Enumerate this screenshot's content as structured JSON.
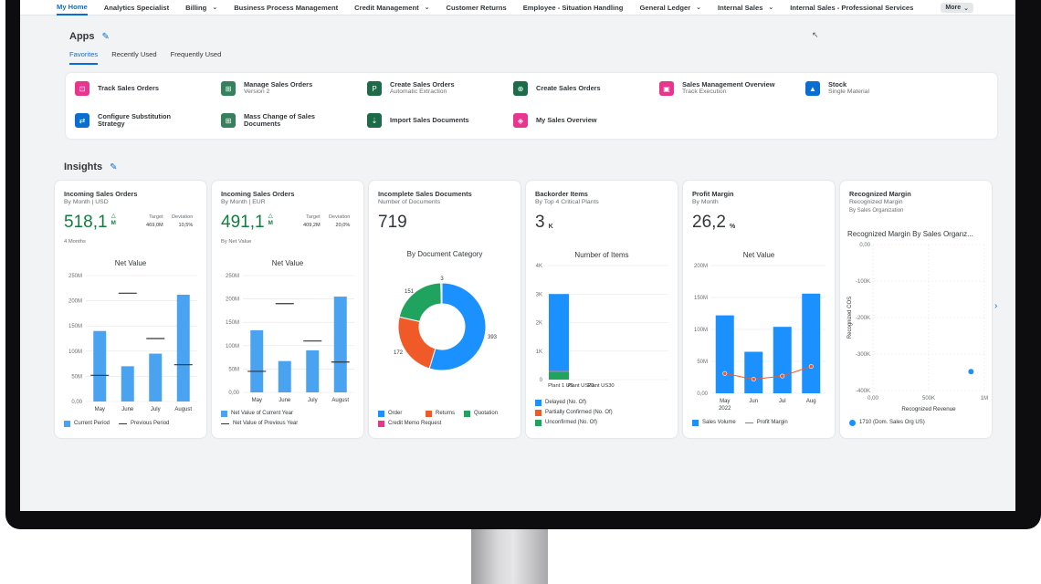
{
  "nav": {
    "items": [
      "My Home",
      "Analytics Specialist",
      "Billing",
      "Business Process Management",
      "Credit Management",
      "Customer Returns",
      "Employee - Situation Handling",
      "General Ledger",
      "Internal Sales",
      "Internal Sales - Professional Services"
    ],
    "chevron_items": [
      2,
      4,
      7,
      8
    ],
    "more": "More"
  },
  "apps": {
    "title": "Apps",
    "tabs": [
      "Favorites",
      "Recently Used",
      "Frequently Used"
    ],
    "tiles": [
      {
        "title": "Track Sales Orders",
        "sub": "",
        "color": "#e8368f",
        "icon": "track-orders-icon"
      },
      {
        "title": "Manage Sales Orders",
        "sub": "Version 2",
        "color": "#36805e",
        "icon": "manage-orders-icon"
      },
      {
        "title": "Create Sales Orders",
        "sub": "Automatic Extraction",
        "color": "#1d6b48",
        "icon": "pdf-extract-icon"
      },
      {
        "title": "Create Sales Orders",
        "sub": "",
        "color": "#1d6b48",
        "icon": "create-order-icon"
      },
      {
        "title": "Sales Management Overview",
        "sub": "Track Execution",
        "color": "#e8368f",
        "icon": "overview-icon"
      },
      {
        "title": "Stock",
        "sub": "Single Material",
        "color": "#0a6ed1",
        "icon": "stock-chart-icon"
      },
      {
        "title": "Configure Substitution",
        "title2": "Strategy",
        "sub": "",
        "color": "#0a6ed1",
        "icon": "substitution-icon"
      },
      {
        "title": "Mass Change of Sales",
        "title2": "Documents",
        "sub": "",
        "color": "#36805e",
        "icon": "mass-change-icon"
      },
      {
        "title": "Import Sales Documents",
        "sub": "",
        "color": "#1d6b48",
        "icon": "import-icon"
      },
      {
        "title": "My Sales Overview",
        "sub": "",
        "color": "#e8368f",
        "icon": "my-overview-icon"
      }
    ]
  },
  "insights": {
    "title": "Insights",
    "cards": [
      {
        "title": "Incoming Sales Orders",
        "subtitle": "By Month | USD",
        "kpi": "518,1",
        "kpi_unit": "M",
        "kpi_indicator": "up",
        "target_label": "Target",
        "target_value": "469,0M",
        "deviation_label": "Deviation",
        "deviation_value": "10,5%",
        "footer": "4 Months"
      },
      {
        "title": "Incoming Sales Orders",
        "subtitle": "By Month | EUR",
        "kpi": "491,1",
        "kpi_unit": "M",
        "kpi_indicator": "up",
        "target_label": "Target",
        "target_value": "409,2M",
        "deviation_label": "Deviation",
        "deviation_value": "20,0%",
        "footer": "By Net Value"
      },
      {
        "title": "Incomplete Sales Documents",
        "subtitle": "Number of Documents",
        "kpi": "719"
      },
      {
        "title": "Backorder Items",
        "subtitle": "By Top 4 Critical Plants",
        "kpi": "3",
        "kpi_unit": "K"
      },
      {
        "title": "Profit Margin",
        "subtitle": "By Month",
        "kpi": "26,2",
        "kpi_unit": "%"
      },
      {
        "title": "Recognized Margin",
        "subtitle": "Recognized Margin",
        "subtitle2": "By Sales Organization"
      }
    ]
  },
  "chart_data": [
    {
      "type": "bar",
      "title": "Net Value",
      "categories": [
        "May",
        "June",
        "July",
        "August"
      ],
      "series": [
        {
          "name": "Current Period",
          "values": [
            140,
            70,
            95,
            212
          ]
        },
        {
          "name": "Previous Period",
          "values": [
            52,
            215,
            125,
            73
          ]
        }
      ],
      "yticks": [
        "0,00",
        "50M",
        "100M",
        "150M",
        "200M",
        "250M"
      ],
      "ylim": [
        0,
        250
      ]
    },
    {
      "type": "bar",
      "title": "Net Value",
      "categories": [
        "May",
        "June",
        "July",
        "August"
      ],
      "series": [
        {
          "name": "Net Value of Current Year",
          "values": [
            133,
            67,
            90,
            205
          ]
        },
        {
          "name": "Net Value of Previous Year",
          "values": [
            45,
            190,
            110,
            65
          ]
        }
      ],
      "yticks": [
        "0,00",
        "50M",
        "100M",
        "150M",
        "200M",
        "250M"
      ],
      "ylim": [
        0,
        250
      ]
    },
    {
      "type": "pie",
      "title": "By Document Category",
      "series": [
        {
          "name": "Order",
          "value": 393,
          "color": "#1b90ff"
        },
        {
          "name": "Returns",
          "value": 172,
          "color": "#f05a28"
        },
        {
          "name": "Quotation",
          "value": 151,
          "color": "#20a35f"
        },
        {
          "name": "Credit Memo Request",
          "value": 3,
          "color": "#e8368f"
        }
      ]
    },
    {
      "type": "bar",
      "title": "Number of Items",
      "categories": [
        "Plant 1 US",
        "Plant US20",
        "Plant US30"
      ],
      "series": [
        {
          "name": "Delayed (No. Of)",
          "values": [
            2.7,
            0,
            0
          ],
          "color": "#1b90ff"
        },
        {
          "name": "Partially Confirmed (No. Of)",
          "values": [
            0.02,
            0,
            0
          ],
          "color": "#f05a28"
        },
        {
          "name": "Unconfirmed (No. Of)",
          "values": [
            0.28,
            0,
            0
          ],
          "color": "#20a35f"
        }
      ],
      "yticks": [
        "0",
        "1K",
        "2K",
        "3K",
        "4K"
      ],
      "ylim": [
        0,
        4
      ]
    },
    {
      "type": "bar",
      "title": "Net Value",
      "categories": [
        "May 2022",
        "Jun",
        "Jul",
        "Aug"
      ],
      "series": [
        {
          "name": "Sales Volume",
          "values": [
            122,
            65,
            104,
            156
          ]
        },
        {
          "name": "Profit Margin",
          "values": [
            31,
            22,
            27,
            42
          ]
        }
      ],
      "yticks": [
        "0,00",
        "50M",
        "100M",
        "150M",
        "200M"
      ],
      "ylim": [
        0,
        200
      ]
    },
    {
      "type": "scatter",
      "title": "Recognized Margin By Sales Organz...",
      "xlabel": "Recognized Revenue",
      "ylabel": "Recognized COS",
      "xticks": [
        "0,00",
        "500K",
        "1M"
      ],
      "yticks": [
        "0,00",
        "-100K",
        "-200K",
        "-300K",
        "-400K"
      ],
      "xlim": [
        0,
        1000
      ],
      "ylim": [
        -400,
        0
      ],
      "series": [
        {
          "name": "1710 (Dom. Sales Org US)",
          "points": [
            [
              880,
              -348
            ]
          ]
        }
      ]
    }
  ]
}
